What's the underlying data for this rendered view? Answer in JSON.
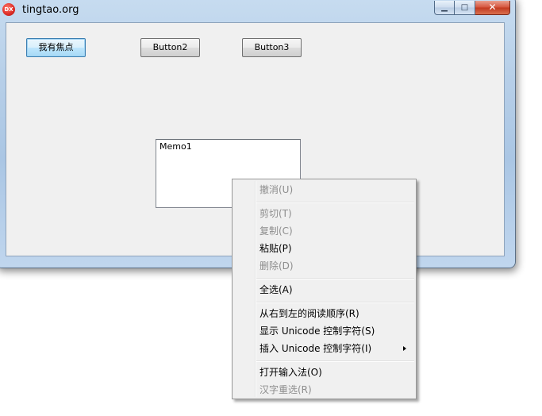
{
  "window": {
    "title": "tingtao.org",
    "icon": "DX",
    "caption": {
      "minimize": "▁",
      "maximize": "□",
      "close": "✕"
    }
  },
  "form": {
    "button1_label": "我有焦点",
    "button2_label": "Button2",
    "button3_label": "Button3",
    "memo_text": "Memo1"
  },
  "context_menu": {
    "undo": "撤消(U)",
    "cut": "剪切(T)",
    "copy": "复制(C)",
    "paste": "粘贴(P)",
    "delete": "删除(D)",
    "select_all": "全选(A)",
    "rtl_reading": "从右到左的阅读顺序(R)",
    "show_unicode": "显示 Unicode 控制字符(S)",
    "insert_unicode": "插入 Unicode 控制字符(I)",
    "open_ime": "打开输入法(O)",
    "reconversion": "汉字重选(R)"
  },
  "colors": {
    "client_bg": "#f0f0f0",
    "disabled_text": "#8d8d8d",
    "focus_border": "#3c7fb1"
  }
}
